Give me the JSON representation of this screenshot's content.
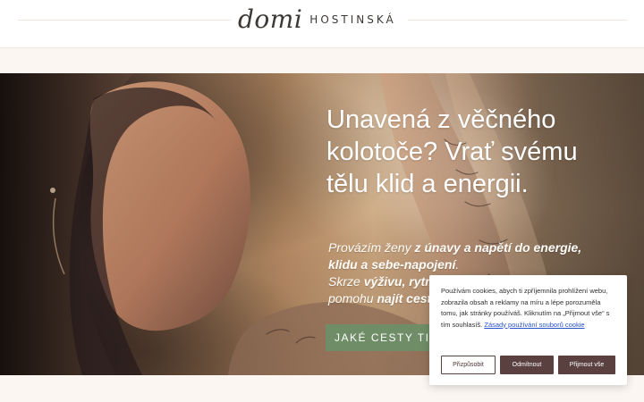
{
  "header": {
    "logo_script": "domi",
    "logo_name": "HOSTINSKÁ"
  },
  "hero": {
    "headline": "Unavená z věčného kolotoče? Vrať svému tělu klid a energii.",
    "subtext_lines": [
      {
        "prefix": "Provázím ženy ",
        "bold": "z únavy a napětí do energie,"
      },
      {
        "bold": "klidu a sebe-napojení",
        "suffix": "."
      },
      {
        "prefix": "Skrze ",
        "bold": "výživu, rytmu",
        "suffix": ""
      },
      {
        "prefix": "pomohu ",
        "bold": "najít cestu",
        "suffix": ""
      }
    ],
    "cta_label": "JAKÉ CESTY TI MO",
    "accent_color": "#6f8d67"
  },
  "cookie_banner": {
    "text": "Používám cookies, abych ti zpříjemnila prohlížení webu, zobrazila obsah a reklamy na míru a lépe porozuměla tomu, jak stránky používáš. Kliknutím na „Přijmout vše“ s tím souhlasíš.",
    "link_label": "Zásady používání souborů cookie",
    "buttons": {
      "customize": "Přizpůsobit",
      "reject": "Odmítnout",
      "accept": "Přijmout vše"
    },
    "button_color": "#5a4140",
    "link_color": "#2752c9"
  }
}
